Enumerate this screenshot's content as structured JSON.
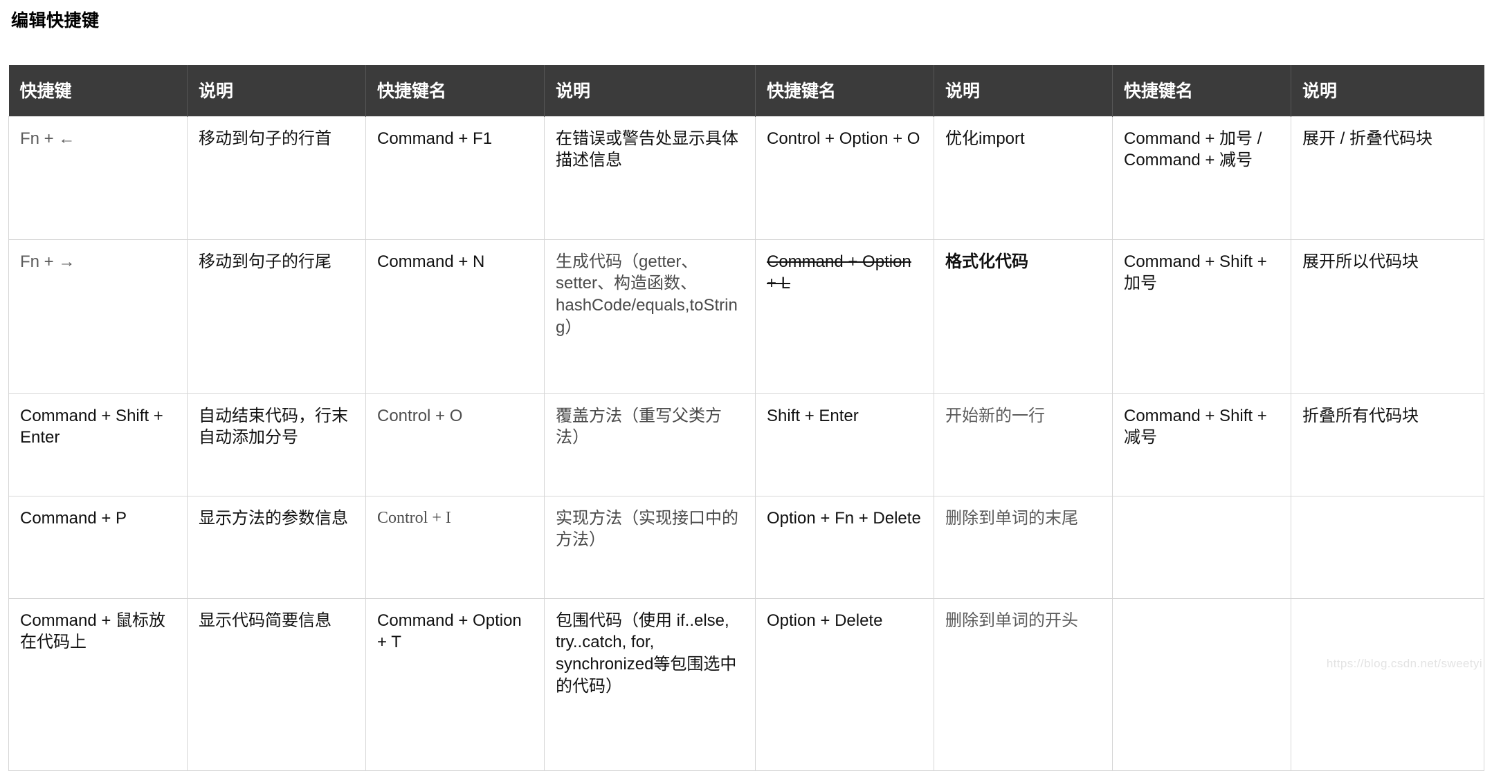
{
  "page_title": "编辑快捷键",
  "watermark": "https://blog.csdn.net/sweetyi",
  "table": {
    "headers": [
      "快捷键",
      "说明",
      "快捷键名",
      "说明",
      "快捷键名",
      "说明",
      "快捷键名",
      "说明"
    ],
    "rows": [
      {
        "c0": "Fn + ←",
        "c1": "移动到句子的行首",
        "c2": "Command + F1",
        "c3": "在错误或警告处显示具体描述信息",
        "c4": "Control + Option + O",
        "c5": "优化import",
        "c6": "Command + 加号 / Command + 减号",
        "c7": "展开 / 折叠代码块"
      },
      {
        "c0": "Fn +  →",
        "c1": "移动到句子的行尾",
        "c2": "Command + N",
        "c3": "生成代码（getter、setter、构造函数、hashCode/equals,toString）",
        "c4": "Command + Option + L",
        "c5": "格式化代码",
        "c6": "Command + Shift + 加号",
        "c7": "展开所以代码块"
      },
      {
        "c0": "Command + Shift + Enter",
        "c1": "自动结束代码，行末自动添加分号",
        "c2": "Control + O",
        "c3": "覆盖方法（重写父类方法）",
        "c4": "Shift + Enter",
        "c5": "开始新的一行",
        "c6": "Command + Shift + 减号",
        "c7": "折叠所有代码块"
      },
      {
        "c0": "Command + P",
        "c1": "显示方法的参数信息",
        "c2": "Control + I",
        "c3": "实现方法（实现接口中的方法）",
        "c4": "Option + Fn + Delete",
        "c5": "删除到单词的末尾",
        "c6": "",
        "c7": ""
      },
      {
        "c0": "Command + 鼠标放在代码上",
        "c1": "显示代码简要信息",
        "c2": "Command + Option + T",
        "c3": "包围代码（使用 if..else, try..catch, for, synchronized等包围选中的代码）",
        "c4": "Option + Delete",
        "c5": "删除到单词的开头",
        "c6": "",
        "c7": ""
      }
    ]
  }
}
